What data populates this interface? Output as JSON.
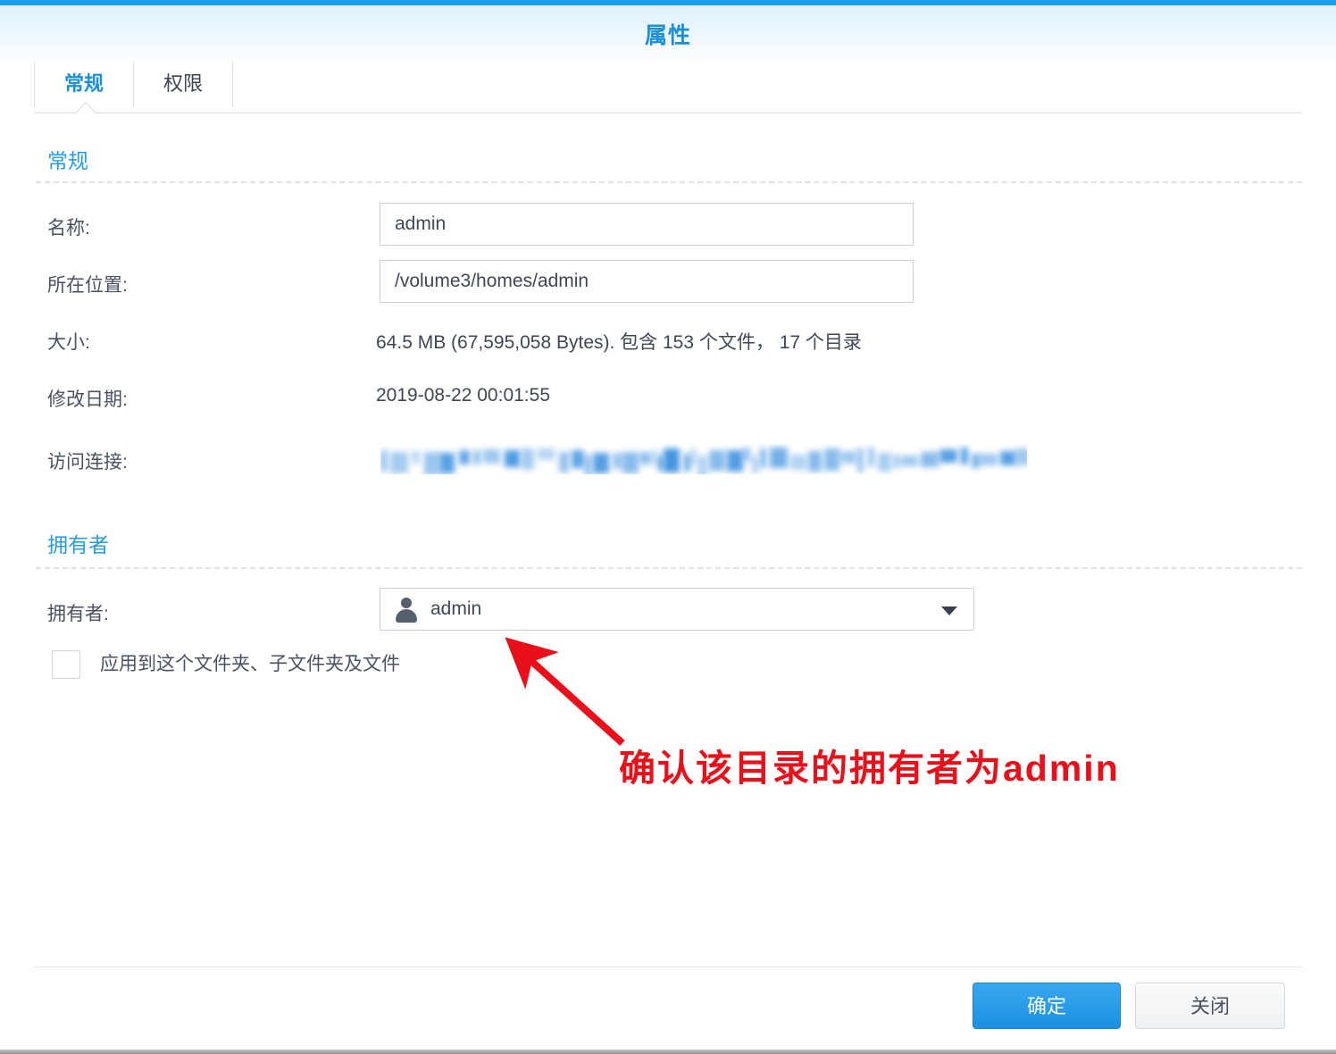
{
  "window": {
    "title": "属性"
  },
  "tabs": [
    {
      "id": "general",
      "label": "常规",
      "active": true
    },
    {
      "id": "permission",
      "label": "权限",
      "active": false
    }
  ],
  "sections": {
    "general": {
      "heading": "常规",
      "rows": {
        "name": {
          "label": "名称:",
          "value": "admin"
        },
        "location": {
          "label": "所在位置:",
          "value": "/volume3/homes/admin"
        },
        "size": {
          "label": "大小:",
          "value": "64.5 MB (67,595,058 Bytes). 包含 153 个文件， 17 个目录"
        },
        "modified": {
          "label": "修改日期:",
          "value": "2019-08-22 00:01:55"
        },
        "link": {
          "label": "访问连接:",
          "value": ""
        }
      }
    },
    "owner": {
      "heading": "拥有者",
      "row": {
        "label": "拥有者:",
        "value": "admin"
      },
      "apply_checkbox": {
        "label": "应用到这个文件夹、子文件夹及文件",
        "checked": false
      }
    }
  },
  "annotation": {
    "text": "确认该目录的拥有者为admin",
    "color": "#e8111b"
  },
  "footer": {
    "ok_label": "确定",
    "close_label": "关闭"
  },
  "colors": {
    "accent": "#1b8fd6",
    "title_bar": "#1a9fe8",
    "section_heading": "#2a9bdd",
    "annotation_red": "#e8111b"
  }
}
